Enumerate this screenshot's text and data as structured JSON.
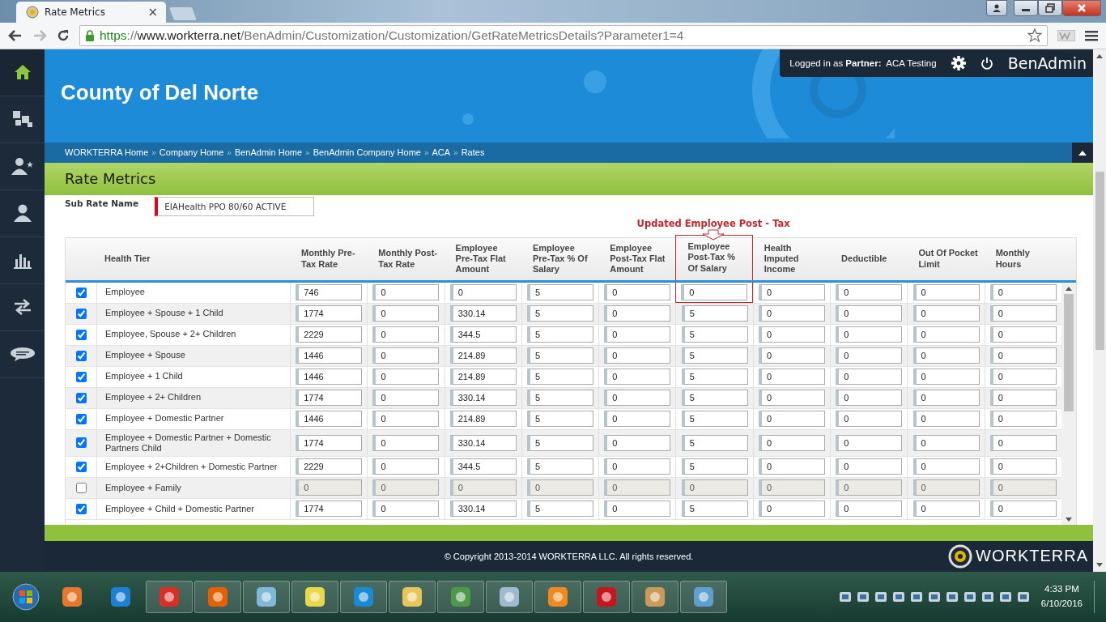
{
  "browser": {
    "tab": {
      "title": "Rate Metrics",
      "close": "×"
    },
    "url": [
      {
        "kind": "scheme",
        "text": "https"
      },
      {
        "kind": "sep",
        "text": "://"
      },
      {
        "kind": "host",
        "text": "www.workterra.net"
      },
      {
        "kind": "path",
        "text": "/BenAdmin/Customization/Customization/GetRateMetricsDetails?Parameter1=4"
      }
    ]
  },
  "sidebar": {
    "items": [
      {
        "kind": "home",
        "selected": true
      },
      {
        "kind": "puzzle",
        "selected": false
      },
      {
        "kind": "user-star",
        "selected": false
      },
      {
        "kind": "user",
        "selected": false
      },
      {
        "kind": "chart",
        "selected": false
      },
      {
        "kind": "arrows",
        "selected": false
      },
      {
        "kind": "chat",
        "selected": false
      }
    ]
  },
  "header": {
    "title": "County of Del Norte",
    "login": "Logged in as **Partner:**  ACA Testing",
    "app_name": "BenAdmin"
  },
  "breadcrumbs": {
    "separator": "»",
    "items": [
      "WORKTERRA Home",
      "Company Home",
      "BenAdmin Home",
      "BenAdmin Company Home",
      "ACA",
      "Rates"
    ]
  },
  "page_title": "Rate Metrics",
  "sub_rate": {
    "label": "Sub Rate Name",
    "value": "EIAHealth PPO 80/60 ACTIVE"
  },
  "table": {
    "tier_heading": "Health Tier",
    "columns": [
      {
        "label": "Monthly Pre-Tax Rate",
        "highlighted": false
      },
      {
        "label": "Monthly Post-Tax Rate",
        "highlighted": false
      },
      {
        "label": "Employee Pre-Tax Flat Amount",
        "highlighted": false
      },
      {
        "label": "Employee Pre-Tax % Of Salary",
        "highlighted": false
      },
      {
        "label": "Employee Post-Tax Flat Amount",
        "highlighted": false
      },
      {
        "label": "Employee Post-Tax % Of Salary",
        "highlighted": true,
        "note": "Updated Employee Post - Tax"
      },
      {
        "label": "Health Imputed Income",
        "highlighted": false
      },
      {
        "label": "Deductible",
        "highlighted": false
      },
      {
        "label": "Out Of Pocket Limit",
        "highlighted": false
      },
      {
        "label": "Monthly Hours",
        "highlighted": false
      }
    ],
    "rows": [
      {
        "checked": true,
        "tier": "Employee",
        "values": [
          "746",
          "0",
          "0",
          "5",
          "0",
          "0",
          "0",
          "0",
          "0",
          "0"
        ]
      },
      {
        "checked": true,
        "tier": "Employee + Spouse + 1 Child",
        "values": [
          "1774",
          "0",
          "330.14",
          "5",
          "0",
          "5",
          "0",
          "0",
          "0",
          "0"
        ]
      },
      {
        "checked": true,
        "tier": "Employee, Spouse + 2+ Children",
        "values": [
          "2229",
          "0",
          "344.5",
          "5",
          "0",
          "5",
          "0",
          "0",
          "0",
          "0"
        ]
      },
      {
        "checked": true,
        "tier": "Employee + Spouse",
        "values": [
          "1446",
          "0",
          "214.89",
          "5",
          "0",
          "5",
          "0",
          "0",
          "0",
          "0"
        ]
      },
      {
        "checked": true,
        "tier": "Employee + 1 Child",
        "values": [
          "1446",
          "0",
          "214.89",
          "5",
          "0",
          "5",
          "0",
          "0",
          "0",
          "0"
        ]
      },
      {
        "checked": true,
        "tier": "Employee + 2+ Children",
        "values": [
          "1774",
          "0",
          "330.14",
          "5",
          "0",
          "5",
          "0",
          "0",
          "0",
          "0"
        ]
      },
      {
        "checked": true,
        "tier": "Employee + Domestic Partner",
        "values": [
          "1446",
          "0",
          "214.89",
          "5",
          "0",
          "5",
          "0",
          "0",
          "0",
          "0"
        ]
      },
      {
        "checked": true,
        "tier": "Employee + Domestic Partner + Domestic Partners Child",
        "values": [
          "1774",
          "0",
          "330.14",
          "5",
          "0",
          "5",
          "0",
          "0",
          "0",
          "0"
        ]
      },
      {
        "checked": true,
        "tier": "Employee + 2+Children + Domestic Partner",
        "values": [
          "2229",
          "0",
          "344.5",
          "5",
          "0",
          "5",
          "0",
          "0",
          "0",
          "0"
        ]
      },
      {
        "checked": false,
        "tier": "Employee + Family",
        "values": [
          "0",
          "0",
          "0",
          "0",
          "0",
          "0",
          "0",
          "0",
          "0",
          "0"
        ]
      },
      {
        "checked": true,
        "tier": "Employee + Child + Domestic Partner",
        "values": [
          "1774",
          "0",
          "330.14",
          "5",
          "0",
          "5",
          "0",
          "0",
          "0",
          "0"
        ]
      }
    ]
  },
  "footer": {
    "copyright": "© Copyright 2013-2014 WORKTERRA LLC. All rights reserved.",
    "logo": "WORKTERRA"
  },
  "taskbar": {
    "time": "4:33 PM",
    "date": "6/10/2016"
  }
}
